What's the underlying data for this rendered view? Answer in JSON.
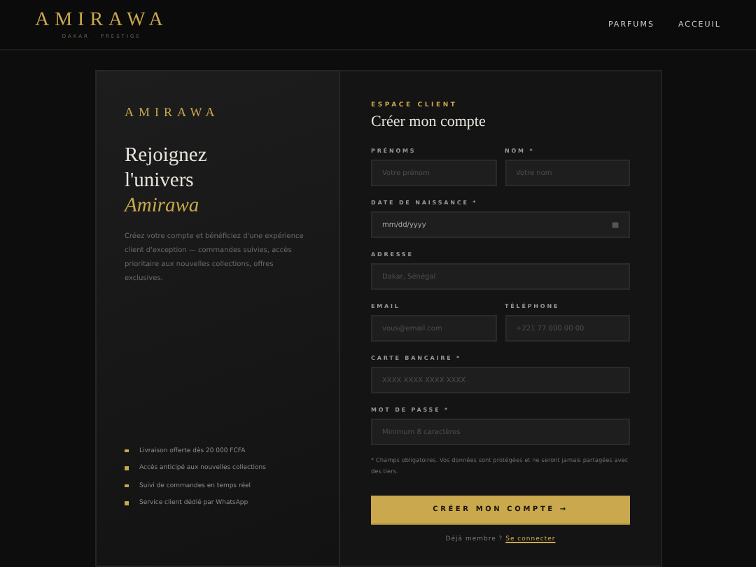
{
  "header": {
    "logo": "AMIRAWA",
    "tagline": "DAKAR · PRESTIGE",
    "nav": [
      {
        "label": "PARFUMS"
      },
      {
        "label": "ACCEUIL"
      }
    ]
  },
  "intro": {
    "brand": "AMIRAWA",
    "heading_lines": [
      "Rejoignez",
      "l'univers"
    ],
    "heading_accent": "Amirawa",
    "description": "Créez votre compte et bénéficiez d'une expérience client d'exception — commandes suivies, accès prioritaire aux nouvelles collections, offres exclusives.",
    "benefits": [
      "Livraison offerte dès 20 000 FCFA",
      "Accès anticipé aux nouvelles collections",
      "Suivi de commandes en temps réel",
      "Service client dédié par WhatsApp"
    ]
  },
  "form": {
    "eyebrow": "ESPACE CLIENT",
    "title": "Créer mon compte",
    "rows": [
      [
        {
          "kind": "text",
          "label": "PRÉNOMS",
          "placeholder": "Votre prénom"
        },
        {
          "kind": "text",
          "label": "NOM *",
          "placeholder": "Votre nom"
        }
      ],
      [
        {
          "kind": "date",
          "label": "DATE DE NAISSANCE *",
          "value": "mm/dd/yyyy"
        }
      ],
      [
        {
          "kind": "text",
          "label": "ADRESSE",
          "placeholder": "Dakar, Sénégal"
        }
      ],
      [
        {
          "kind": "text",
          "label": "EMAIL",
          "placeholder": "vous@email.com"
        },
        {
          "kind": "text",
          "label": "TÉLÉPHONE",
          "placeholder": "+221 77 000 00 00"
        }
      ],
      [
        {
          "kind": "text",
          "label": "CARTE BANCAIRE *",
          "placeholder": "XXXX XXXX XXXX XXXX"
        }
      ],
      [
        {
          "kind": "text",
          "label": "MOT DE PASSE *",
          "placeholder": "Minimum 8 caractères"
        }
      ]
    ],
    "note": "* Champs obligatoires. Vos données sont protégées et ne seront jamais partagées avec des tiers.",
    "submit": "CRÉER MON COMPTE →",
    "login_prompt": "Déjà membre ?",
    "login_link": "Se connecter"
  }
}
